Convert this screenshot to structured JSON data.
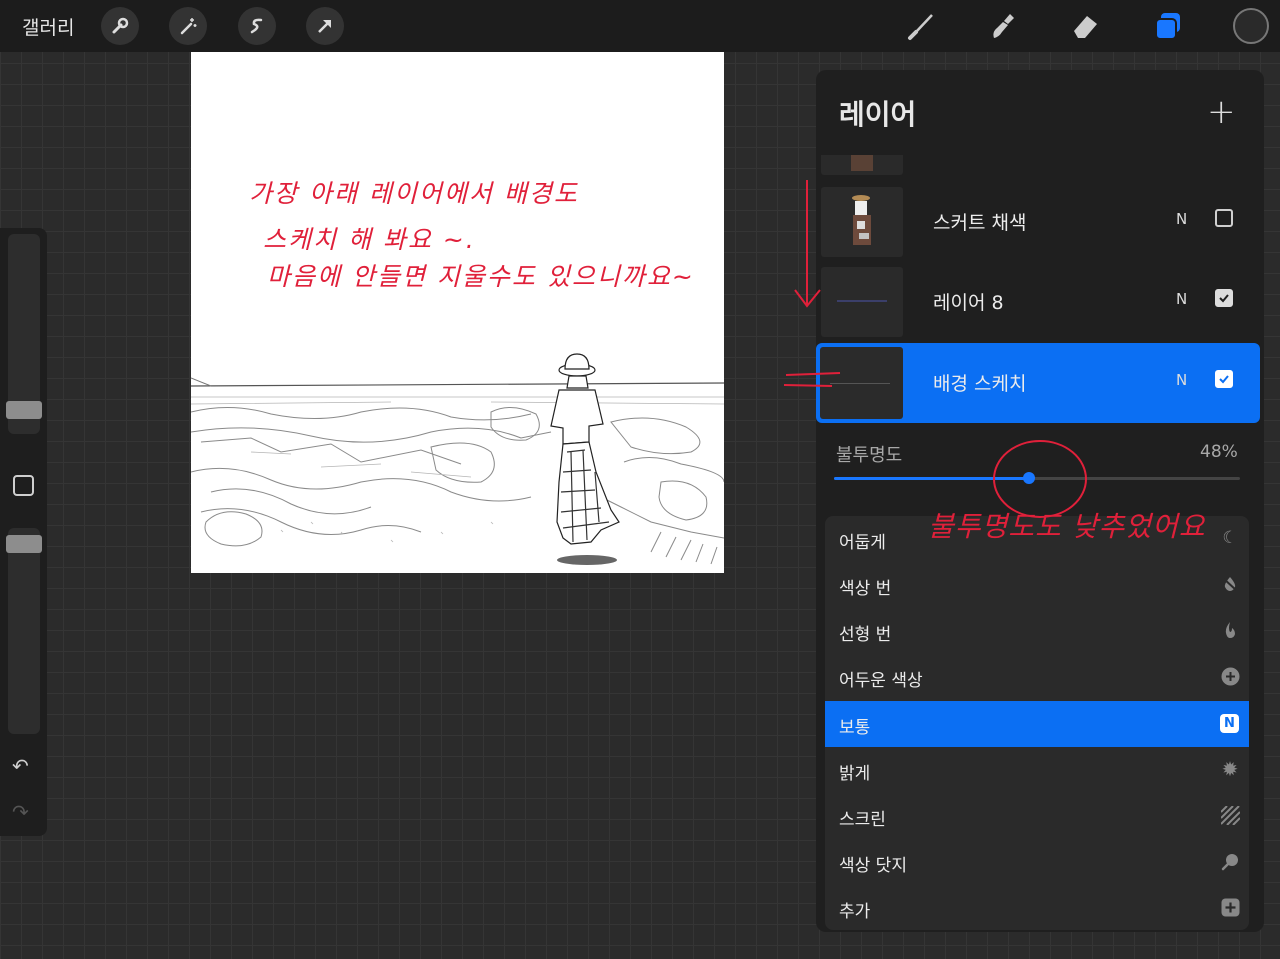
{
  "topbar": {
    "gallery": "갤러리",
    "tools_left": [
      "wrench-icon",
      "magic-wand-icon",
      "selection-icon",
      "transform-arrow-icon"
    ],
    "tools_right": [
      "brush-icon",
      "smudge-icon",
      "eraser-icon",
      "layers-icon"
    ],
    "accent": "#1977ff"
  },
  "canvas": {
    "note_line1": "가장 아래 레이어에서  배경도",
    "note_line2": "스케치 해 봐요 ~.",
    "note_line3": "마음에  안들면  지울수도 있으니까요~",
    "opacity_note": "불투명도도 낮추었어요"
  },
  "layers_panel": {
    "title": "레이어",
    "add_label": "+",
    "layers": [
      {
        "name": "스커트 채색",
        "mode": "N",
        "visible": false
      },
      {
        "name": "레이어 8",
        "mode": "N",
        "visible": true
      },
      {
        "name": "배경 스케치",
        "mode": "N",
        "visible": true,
        "selected": true
      }
    ],
    "opacity_label": "불투명도",
    "opacity_value": "48%",
    "opacity": 0.48
  },
  "blend_modes": [
    {
      "label": "어둡게",
      "icon": "moon-icon"
    },
    {
      "label": "색상 번",
      "icon": "burn-drop-icon"
    },
    {
      "label": "선형 번",
      "icon": "flame-icon"
    },
    {
      "label": "어두운 색상",
      "icon": "plus-circle-icon"
    },
    {
      "label": "보통",
      "icon": "N",
      "active": true
    },
    {
      "label": "밝게",
      "icon": "sun-icon"
    },
    {
      "label": "스크린",
      "icon": "hatch-icon"
    },
    {
      "label": "색상 닷지",
      "icon": "magnifier-icon"
    },
    {
      "label": "추가",
      "icon": "plus-square-icon"
    }
  ]
}
